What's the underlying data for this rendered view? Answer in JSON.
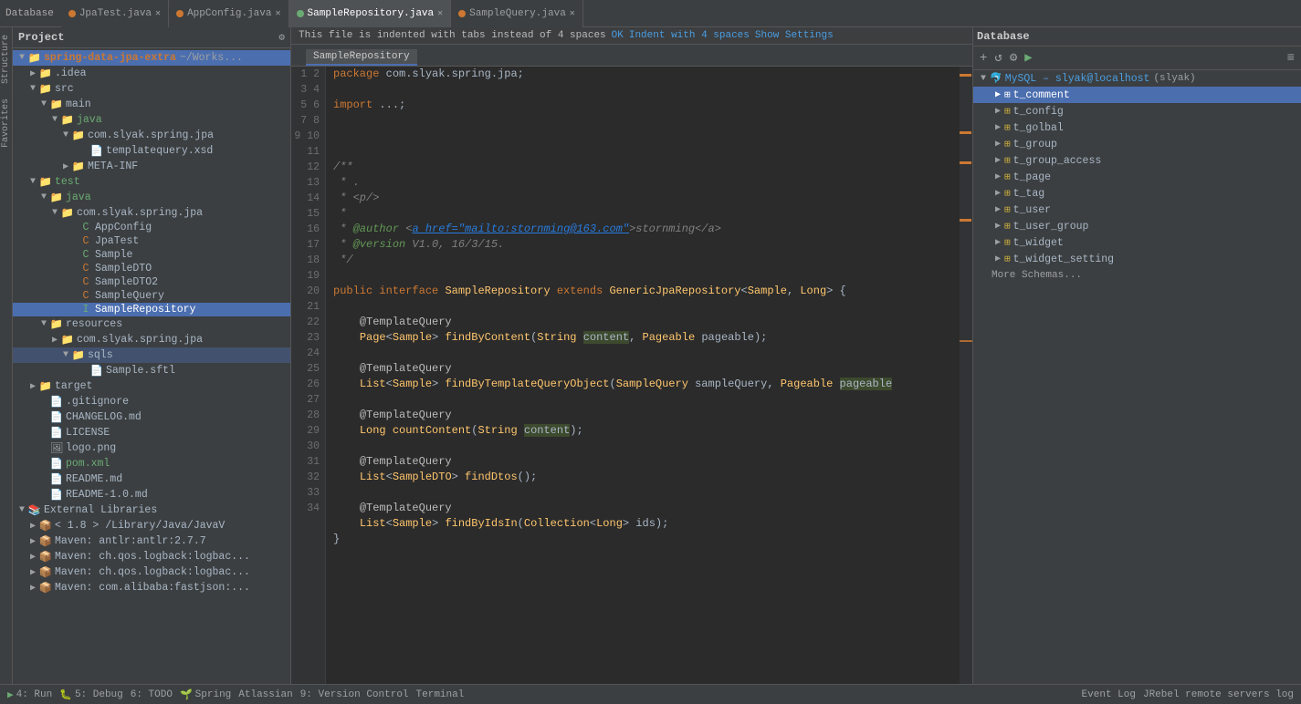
{
  "topbar": {
    "title": "Database"
  },
  "tabs": [
    {
      "id": "jpatest",
      "label": "JpaTest.java",
      "type": "java",
      "active": false
    },
    {
      "id": "appconfig",
      "label": "AppConfig.java",
      "type": "java",
      "active": false
    },
    {
      "id": "samplerepo",
      "label": "SampleRepository.java",
      "type": "java",
      "active": true
    },
    {
      "id": "samplequery",
      "label": "SampleQuery.java",
      "type": "java",
      "active": false
    }
  ],
  "hint": {
    "text": "This file is indented with tabs instead of 4 spaces",
    "ok_label": "OK",
    "indent_label": "Indent with 4 spaces",
    "settings_label": "Show Settings"
  },
  "filename": "SampleRepository",
  "project": {
    "title": "Project",
    "root": "spring-data-jpa-extra",
    "root_path": "~/Works..."
  },
  "warning_text": "This file is indented with tabs instead of 4 spaces",
  "db": {
    "title": "Database",
    "connection": "MySQL - slyak@localhost",
    "user": "(slyak)",
    "selected_table": "t_comment",
    "tables": [
      "t_comment",
      "t_config",
      "t_golbal",
      "t_group",
      "t_group_access",
      "t_page",
      "t_tag",
      "t_user",
      "t_user_group",
      "t_widget",
      "t_widget_setting"
    ],
    "more_schemas": "More Schemas..."
  },
  "bottom_bar": {
    "items": [
      "4: Run",
      "5: Debug",
      "6: TODO",
      "Spring",
      "Atlassian",
      "9: Version Control",
      "Terminal",
      "Event Log",
      "JRebel remote servers log"
    ]
  },
  "code": {
    "lines": [
      {
        "n": 1,
        "content": "package com.slyak.spring.jpa;"
      },
      {
        "n": 2,
        "content": ""
      },
      {
        "n": 3,
        "content": "import ...;"
      },
      {
        "n": 4,
        "content": ""
      },
      {
        "n": 5,
        "content": ""
      },
      {
        "n": 6,
        "content": ""
      },
      {
        "n": 7,
        "content": ""
      },
      {
        "n": 8,
        "content": ""
      },
      {
        "n": 9,
        "content": ""
      },
      {
        "n": 10,
        "content": "/**"
      },
      {
        "n": 11,
        "content": " * ."
      },
      {
        "n": 12,
        "content": " * <p/>"
      },
      {
        "n": 13,
        "content": " *"
      },
      {
        "n": 14,
        "content": " * @author <a href=\"mailto:stornming@163.com\">stornming</a>"
      },
      {
        "n": 15,
        "content": " * @version V1.0, 16/3/15."
      },
      {
        "n": 16,
        "content": " */"
      },
      {
        "n": 17,
        "content": ""
      },
      {
        "n": 18,
        "content": "public interface SampleRepository extends GenericJpaRepository<Sample, Long> {"
      },
      {
        "n": 19,
        "content": ""
      },
      {
        "n": 20,
        "content": "    @TemplateQuery"
      },
      {
        "n": 21,
        "content": "    Page<Sample> findByContent(String content, Pageable pageable);"
      },
      {
        "n": 22,
        "content": ""
      },
      {
        "n": 23,
        "content": "    @TemplateQuery"
      },
      {
        "n": 24,
        "content": "    List<Sample> findByTemplateQueryObject(SampleQuery sampleQuery, Pageable pageable"
      },
      {
        "n": 25,
        "content": ""
      },
      {
        "n": 26,
        "content": "    @TemplateQuery"
      },
      {
        "n": 27,
        "content": "    Long countContent(String content);"
      },
      {
        "n": 28,
        "content": ""
      },
      {
        "n": 29,
        "content": "    @TemplateQuery"
      },
      {
        "n": 30,
        "content": "    List<SampleDTO> findDtos();"
      },
      {
        "n": 31,
        "content": ""
      },
      {
        "n": 32,
        "content": "    @TemplateQuery"
      },
      {
        "n": 33,
        "content": "    List<Sample> findByIdsIn(Collection<Long> ids);"
      },
      {
        "n": 34,
        "content": "}"
      }
    ]
  }
}
